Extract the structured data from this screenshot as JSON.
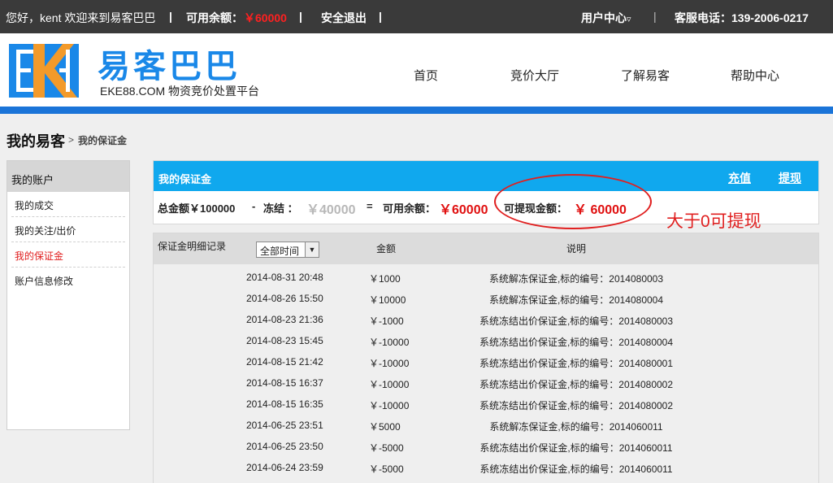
{
  "topbar": {
    "greeting": "您好，kent 欢迎来到易客巴巴",
    "balance_label": "可用余额：",
    "balance_value": "￥60000",
    "logout": "安全退出",
    "user_center": "用户中心",
    "user_center_arrow": "▿",
    "phone": "客服电话：139-2006-0217",
    "sep": "|"
  },
  "header": {
    "logo_title": "易客巴巴",
    "logo_sub": "EKE88.COM 物资竞价处置平台",
    "logo_letters": "EKE",
    "nav": [
      "首页",
      "竞价大厅",
      "了解易客",
      "帮助中心"
    ]
  },
  "breadcrumb": {
    "main": "我的易客",
    "arrow": ">",
    "sub": "我的保证金"
  },
  "sidebar": {
    "title": "我的账户",
    "items": [
      "我的成交",
      "我的关注/出价",
      "我的保证金",
      "账户信息修改"
    ],
    "active_index": 2
  },
  "panel": {
    "title": "我的保证金",
    "recharge": "充值",
    "withdraw": "提现",
    "total_label": "总金额￥100000",
    "minus": "-",
    "frozen_label": "冻结 ：",
    "frozen_value": "￥40000",
    "equals": "=",
    "available_label": "可用余额：",
    "available_value": "￥60000",
    "withdrawable_label": "可提现金额：",
    "withdrawable_value": "￥ 60000"
  },
  "annotation": "大于0可提现",
  "records": {
    "header_label": "保证金明细记录",
    "filter_value": "全部时间",
    "col_amount": "金额",
    "col_desc": "说明",
    "rows": [
      {
        "time": "2014-08-31 20:48",
        "amount": "￥1000",
        "desc": "系统解冻保证金,标的编号：2014080003"
      },
      {
        "time": "2014-08-26 15:50",
        "amount": "￥10000",
        "desc": "系统解冻保证金,标的编号：2014080004"
      },
      {
        "time": "2014-08-23 21:36",
        "amount": "￥-1000",
        "desc": "系统冻结出价保证金,标的编号：2014080003"
      },
      {
        "time": "2014-08-23 15:45",
        "amount": "￥-10000",
        "desc": "系统冻结出价保证金,标的编号：2014080004"
      },
      {
        "time": "2014-08-15 21:42",
        "amount": "￥-10000",
        "desc": "系统冻结出价保证金,标的编号：2014080001"
      },
      {
        "time": "2014-08-15 16:37",
        "amount": "￥-10000",
        "desc": "系统冻结出价保证金,标的编号：2014080002"
      },
      {
        "time": "2014-08-15 16:35",
        "amount": "￥-10000",
        "desc": "系统冻结出价保证金,标的编号：2014080002"
      },
      {
        "time": "2014-06-25 23:51",
        "amount": "￥5000",
        "desc": "系统解冻保证金,标的编号：2014060011"
      },
      {
        "time": "2014-06-25 23:50",
        "amount": "￥-5000",
        "desc": "系统冻结出价保证金,标的编号：2014060011"
      },
      {
        "time": "2014-06-24 23:59",
        "amount": "￥-5000",
        "desc": "系统冻结出价保证金,标的编号：2014060011"
      }
    ]
  },
  "colors": {
    "topbar": "#3a3a3a",
    "accent_blue": "#10a8ee",
    "brand_blue": "#1a74d8",
    "logo_orange": "#f39a2a",
    "alert_red": "#e01010"
  }
}
